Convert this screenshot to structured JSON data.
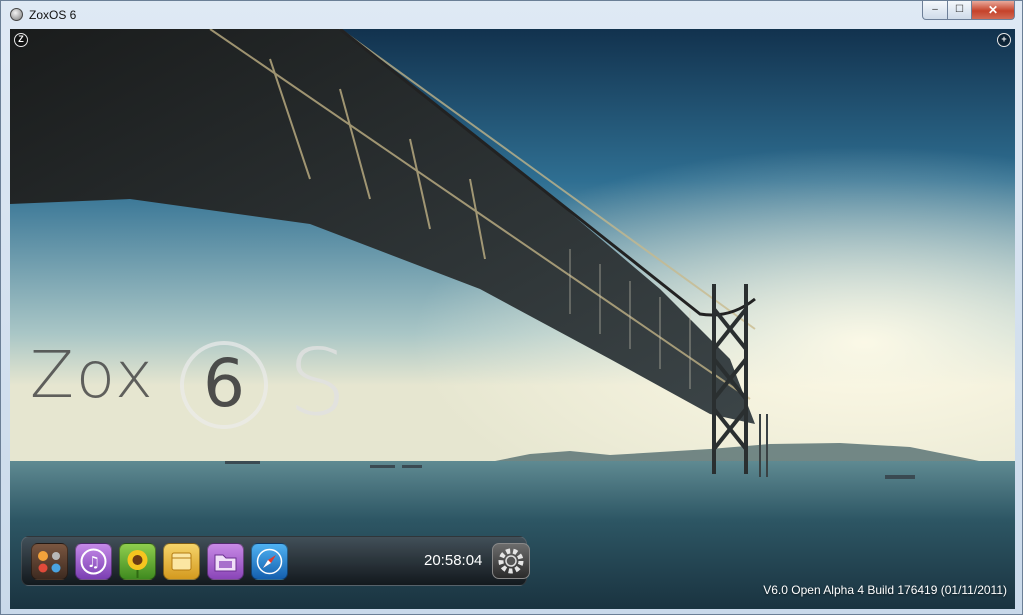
{
  "window": {
    "title": "ZoxOS 6",
    "controls": {
      "minimize": "‒",
      "maximize": "☐",
      "close": "✕"
    }
  },
  "desktop": {
    "corner_left_label": "Z",
    "corner_right_label": "+",
    "logo": {
      "word": "Zox",
      "number": "6",
      "letter": "S"
    },
    "version_text": "V6.0 Open Alpha 4 Build 176419 (01/11/2011)"
  },
  "dock": {
    "clock": "20:58:04",
    "apps": [
      {
        "name": "apps-grid-icon"
      },
      {
        "name": "music-icon"
      },
      {
        "name": "photos-sunflower-icon"
      },
      {
        "name": "notes-icon"
      },
      {
        "name": "folder-icon"
      },
      {
        "name": "browser-compass-icon"
      }
    ],
    "settings_icon": "gear-icon"
  },
  "colors": {
    "dock_top": "#464f58",
    "clock_text": "#ffffff",
    "sky_top": "#1d3c58",
    "sea": "#2c5464"
  }
}
